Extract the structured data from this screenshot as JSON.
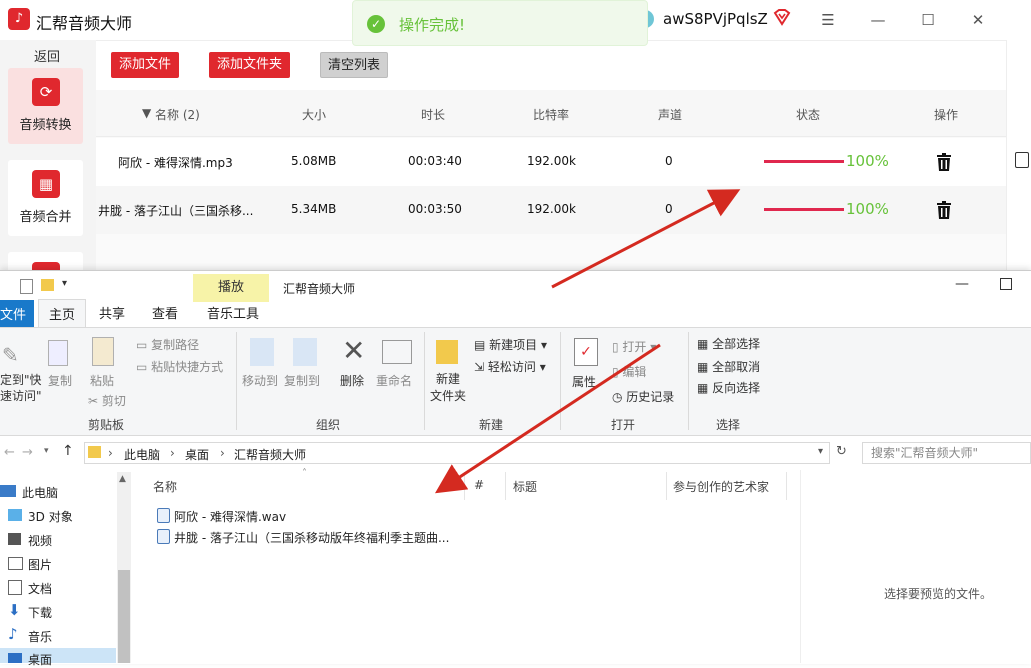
{
  "app": {
    "title": "汇帮音频大师",
    "toast": "操作完成!",
    "username": "awS8PVjPqlsZ",
    "back": "返回",
    "nav": [
      {
        "label": "音频转换",
        "active": true
      },
      {
        "label": "音频合并",
        "active": false
      }
    ],
    "buttons": {
      "add_file": "添加文件",
      "add_folder": "添加文件夹",
      "clear": "清空列表"
    },
    "columns": {
      "name": "名称 (2)",
      "size": "大小",
      "duration": "时长",
      "bitrate": "比特率",
      "channel": "声道",
      "status": "状态",
      "action": "操作"
    },
    "rows": [
      {
        "name": "阿欣 - 难得深情.mp3",
        "size": "5.08MB",
        "duration": "00:03:40",
        "bitrate": "192.00k",
        "channel": "0",
        "progress": "100%"
      },
      {
        "name": "井胧 - 落子江山（三国杀移...",
        "size": "5.34MB",
        "duration": "00:03:50",
        "bitrate": "192.00k",
        "channel": "0",
        "progress": "100%"
      }
    ],
    "colors": {
      "brand": "#e0282e",
      "success": "#67c23a",
      "progress": "#e0284e"
    }
  },
  "explorer": {
    "title": "汇帮音频大师",
    "context_tab": "播放",
    "tabs": [
      "文件",
      "主页",
      "共享",
      "查看",
      "音乐工具"
    ],
    "ribbon": {
      "pin": "定到\"快\n速访问\"",
      "copy": "复制",
      "paste": "粘贴",
      "copy_path": "复制路径",
      "paste_shortcut": "粘贴快捷方式",
      "cut": "剪切",
      "clipboard": "剪贴板",
      "move_to": "移动到",
      "copy_to": "复制到",
      "delete": "删除",
      "rename": "重命名",
      "organize": "组织",
      "new_folder": "新建\n文件夹",
      "new_item": "新建项目",
      "easy_access": "轻松访问",
      "new": "新建",
      "properties": "属性",
      "open": "打开",
      "edit": "编辑",
      "history": "历史记录",
      "open_group": "打开",
      "select_all": "全部选择",
      "select_none": "全部取消",
      "invert": "反向选择",
      "select": "选择"
    },
    "breadcrumb": [
      "此电脑",
      "桌面",
      "汇帮音频大师"
    ],
    "search_placeholder": "搜索\"汇帮音频大师\"",
    "tree": [
      "此电脑",
      "3D 对象",
      "视频",
      "图片",
      "文档",
      "下载",
      "音乐",
      "桌面"
    ],
    "columns": {
      "name": "名称",
      "num": "#",
      "title": "标题",
      "artist": "参与创作的艺术家"
    },
    "files": [
      "阿欣 - 难得深情.wav",
      "井胧 - 落子江山（三国杀移动版年终福利季主题曲..."
    ],
    "preview": "选择要预览的文件。"
  }
}
